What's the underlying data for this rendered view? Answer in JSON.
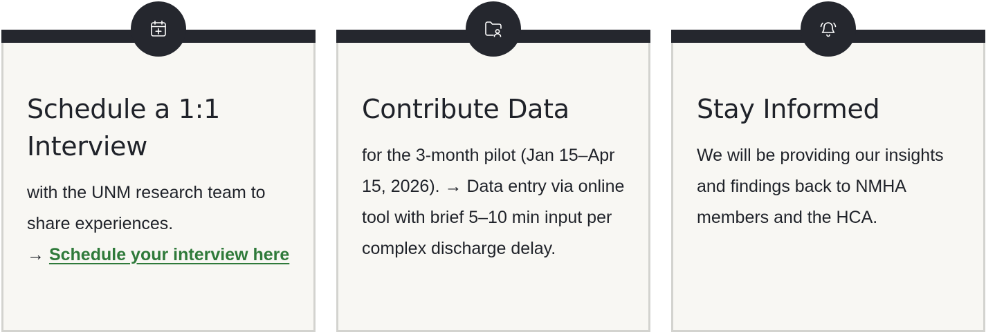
{
  "cards": [
    {
      "icon": "calendar-plus-icon",
      "title": "Schedule a 1:1 Interview",
      "body": "with the UNM research team to share experiences.",
      "arrow": "→",
      "link_label": "Schedule your interview here"
    },
    {
      "icon": "folder-user-icon",
      "title": "Contribute Data",
      "body": "for the 3-month pilot (Jan 15–Apr 15, 2026). → Data entry via online tool with brief 5–10 min input per complex discharge delay."
    },
    {
      "icon": "bell-ring-icon",
      "title": "Stay Informed",
      "body": "We will be providing our insights and findings back to NMHA members and the HCA."
    }
  ],
  "colors": {
    "card_bg": "#f8f7f3",
    "card_border": "#d3d3cf",
    "header_dark": "#25272e",
    "text": "#1f2229",
    "link": "#2f7a3a"
  }
}
